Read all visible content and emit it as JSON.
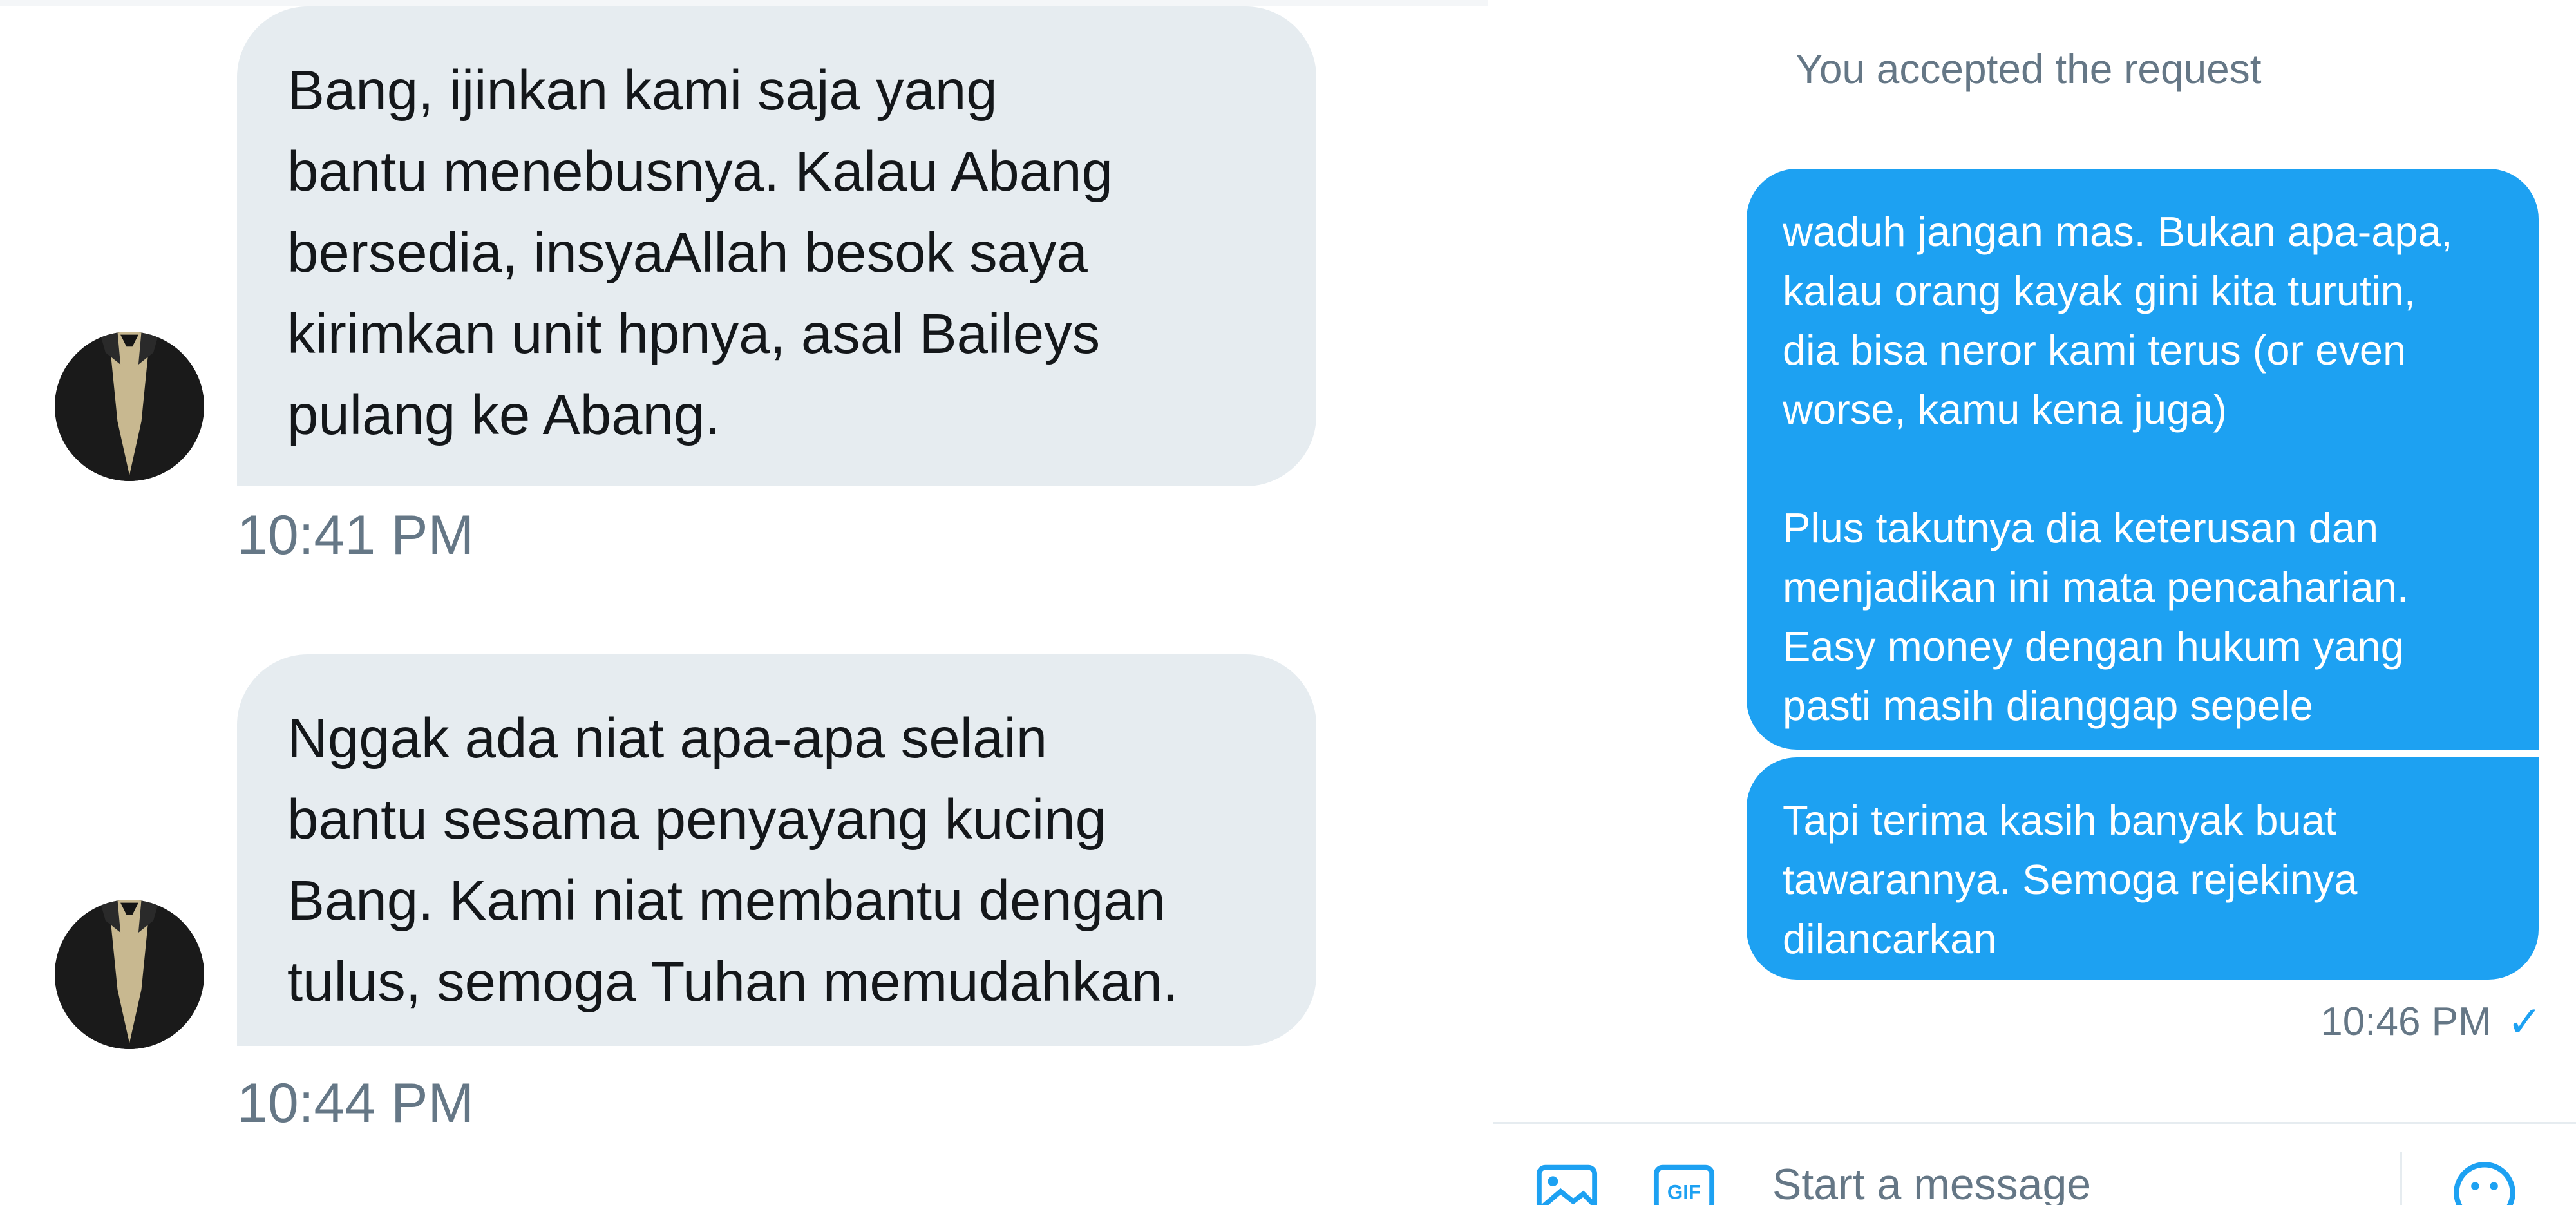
{
  "left": {
    "messages": [
      {
        "lines": [
          "Bang, ijinkan kami saja yang",
          "bantu menebusnya. Kalau Abang",
          "bersedia, insyaAllah besok saya",
          "kirimkan unit hpnya, asal Baileys",
          "pulang ke Abang."
        ],
        "time": "10:41 PM"
      },
      {
        "lines": [
          "Nggak ada niat apa-apa selain",
          "bantu sesama penyayang kucing",
          "Bang. Kami niat membantu dengan",
          "tulus, semoga Tuhan memudahkan."
        ],
        "time": "10:44 PM"
      }
    ]
  },
  "right": {
    "status_note": "You accepted the request",
    "messages": [
      {
        "paragraphs": [
          [
            "waduh jangan mas. Bukan apa-apa,",
            "kalau orang kayak gini kita turutin,",
            "dia bisa neror kami terus (or even",
            "worse, kamu kena juga)"
          ],
          [
            "Plus takutnya dia keterusan dan",
            "menjadikan ini mata pencaharian.",
            "Easy money dengan hukum yang",
            "pasti masih dianggap sepele"
          ]
        ]
      },
      {
        "lines": [
          "Tapi terima kasih banyak buat",
          "tawarannya. Semoga rejekinya",
          "dilancarkan"
        ]
      }
    ],
    "last_time": "10:46 PM",
    "read_check": "✓",
    "composer": {
      "placeholder": "Start a message",
      "icons": [
        "media-icon",
        "gif-icon",
        "emoji-icon"
      ],
      "gif_label": "GIF"
    }
  },
  "colors": {
    "incoming_bubble": "#e6ecf0",
    "outgoing_bubble": "#1da1f2",
    "muted_text": "#657786",
    "accent": "#1da1f2"
  }
}
